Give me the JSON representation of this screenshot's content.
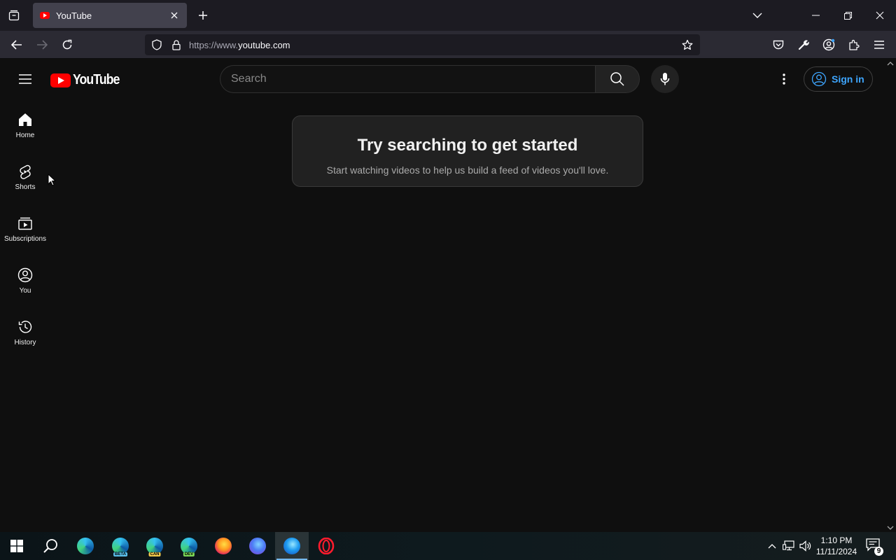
{
  "browser": {
    "tab": {
      "title": "YouTube"
    },
    "url": {
      "prefix": "https://www.",
      "domain": "youtube.com"
    }
  },
  "youtube": {
    "logo_text": "YouTube",
    "search": {
      "placeholder": "Search"
    },
    "signin_label": "Sign in",
    "sidebar": {
      "items": [
        {
          "label": "Home",
          "icon": "home-icon"
        },
        {
          "label": "Shorts",
          "icon": "shorts-icon"
        },
        {
          "label": "Subscriptions",
          "icon": "subscriptions-icon"
        },
        {
          "label": "You",
          "icon": "you-icon"
        },
        {
          "label": "History",
          "icon": "history-icon"
        }
      ]
    },
    "prompt": {
      "title": "Try searching to get started",
      "subtitle": "Start watching videos to help us build a feed of videos you'll love."
    }
  },
  "taskbar": {
    "edge_badges": [
      "BETA",
      "CAN",
      "DEV"
    ],
    "clock": {
      "time": "1:10 PM",
      "date": "11/11/2024"
    },
    "notification_count": "9"
  },
  "colors": {
    "youtube_red": "#ff0000",
    "signin_blue": "#3ea6ff",
    "page_bg": "#0f0f0f"
  }
}
